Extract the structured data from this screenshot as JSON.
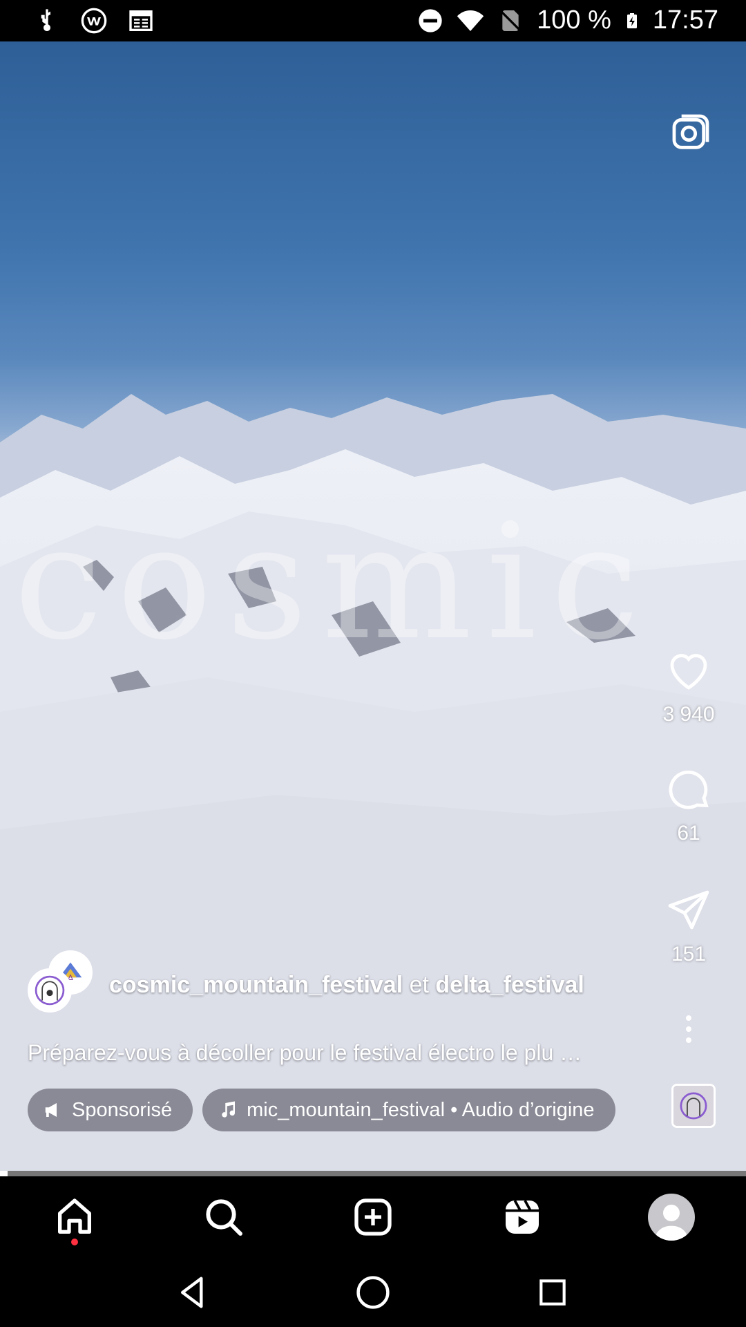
{
  "status_bar": {
    "battery_percent": "100 %",
    "time": "17:57",
    "left_icons": [
      "usb-icon",
      "vpn-icon",
      "news-icon"
    ],
    "right_icons": [
      "dnd-icon",
      "wifi-icon",
      "no-sim-icon",
      "battery-charging-icon"
    ]
  },
  "video": {
    "watermark_text": "cosmic"
  },
  "actions": {
    "likes": "3 940",
    "comments": "61",
    "shares": "151"
  },
  "post": {
    "author_primary": "cosmic_mountain_festival",
    "author_joiner": " et ",
    "author_secondary": "delta_festival",
    "caption": "Préparez-vous à décoller pour le festival électro le plu …",
    "sponsored_label": "Sponsorisé",
    "audio_label": "mic_mountain_festival • Audio d’origine",
    "progress": 0.01
  },
  "nav": {
    "items": [
      "home-icon",
      "search-icon",
      "create-icon",
      "reels-icon",
      "profile-avatar"
    ],
    "home_notification": true
  },
  "colors": {
    "notification_dot": "#ff3040",
    "nav_background": "#000000"
  }
}
